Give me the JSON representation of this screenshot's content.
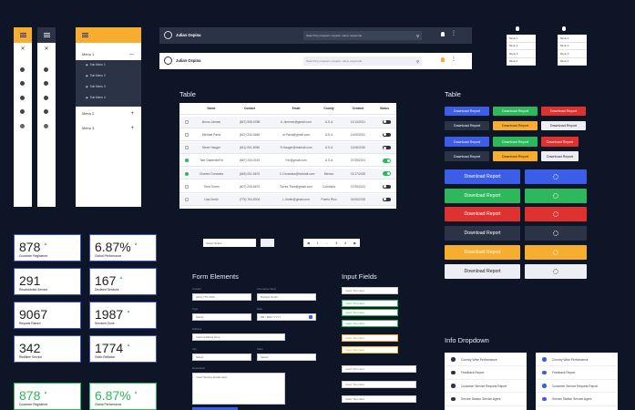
{
  "colors": {
    "bg": "#0e1526",
    "yellow": "#f7ae2f",
    "blue": "#3b5de7",
    "green": "#2eb85c",
    "red": "#e03131",
    "dark": "#2b3447",
    "light": "#eceef3"
  },
  "header": {
    "user": "Julian Ospina",
    "search_placeholder": "Search by prospect, request, name, keywords"
  },
  "sidebar_big": {
    "items": [
      {
        "label": "Menu 1"
      },
      {
        "label": "Sub Menu 1"
      },
      {
        "label": "Sub Menu 2"
      },
      {
        "label": "Sub Menu 3"
      },
      {
        "label": "Sub Menu 4"
      },
      {
        "label": "Menu 2"
      },
      {
        "label": "Menu 3"
      }
    ]
  },
  "small_menus": {
    "left": [
      "Menu 1",
      "Menu 2",
      "Menu 3",
      "Menu 4"
    ],
    "right": [
      "Menu 1",
      "Menu 2",
      "Menu 3",
      "Menu 4"
    ]
  },
  "table": {
    "title": "Table",
    "columns": [
      "Name",
      "Contact",
      "Email",
      "County",
      "Created",
      "Status"
    ],
    "rows": [
      {
        "name": "Bruno Jaimes",
        "contact": "(667) 998-0098",
        "email": "b.Jimenez@gmail.com",
        "county": "U.S.A",
        "created": "11/14/2021",
        "checked": false,
        "status": false
      },
      {
        "name": "Michael Parra",
        "contact": "(612) 234-0660",
        "email": "m.Parra@gmail.com",
        "county": "U.S.A",
        "created": "11/05/2021",
        "checked": false,
        "status": false
      },
      {
        "name": "Steve Hauger",
        "contact": "(611) 001-5050",
        "email": "S.Hauger@hotmail.com",
        "county": "U.S.A",
        "created": "11/08/2020",
        "checked": false,
        "status": false
      },
      {
        "name": "Tom Gabrielle/Fei",
        "contact": "(667) 234-0019",
        "email": "Fei@gmail.com",
        "county": "U.S.A",
        "created": "07/25/2021",
        "checked": true,
        "status": true
      },
      {
        "name": "Charles Gonzales",
        "contact": "(645) 001-5670",
        "email": "C.Gonzales@hotmail.com",
        "county": "Mexico",
        "created": "01/17/2020",
        "checked": true,
        "status": true
      },
      {
        "name": "Thea Torres",
        "contact": "(607) 235-6670",
        "email": "Torres.Thea@gmail.com",
        "county": "Colombia",
        "created": "07/25/2021",
        "checked": false,
        "status": false
      },
      {
        "name": "Lisa Smith",
        "contact": "(775) 764-5004",
        "email": "L.Smith@gmail.com",
        "county": "Puerto Rico",
        "created": "01/06/2020",
        "checked": false,
        "status": false
      }
    ],
    "select_placeholder": "Select Select",
    "pagination": [
      "◀",
      "1",
      "...",
      "5",
      "6",
      "▶"
    ]
  },
  "buttons": {
    "title": "Table",
    "label": "Download Report"
  },
  "stats": [
    {
      "value": "878",
      "label": "Customer Registered",
      "trend": "up"
    },
    {
      "value": "6.87%",
      "label": "Global Performance",
      "trend": "up"
    },
    {
      "value": "291",
      "label": "Rescheduled Service",
      "trend": "down"
    },
    {
      "value": "167",
      "label": "Declined Services",
      "trend": "up"
    },
    {
      "value": "9067",
      "label": "Request Raised",
      "trend": "down"
    },
    {
      "value": "1987",
      "label": "Services Gone",
      "trend": "up"
    },
    {
      "value": "342",
      "label": "Realtime Service",
      "trend": "down"
    },
    {
      "value": "1774",
      "label": "Video Reflation",
      "trend": "up"
    },
    {
      "value": "878",
      "label": "Customer Registered",
      "trend": "up"
    },
    {
      "value": "6.87%",
      "label": "Global Performance",
      "trend": "up"
    }
  ],
  "form": {
    "title": "Form Elements",
    "fields": [
      {
        "label": "Contact",
        "value": "(213) 775-7490"
      },
      {
        "label": "Username Name",
        "value": "Richard Smith"
      },
      {
        "label": "Type",
        "value": "Select"
      },
      {
        "label": "Date",
        "value": "DD / MM / YYYY"
      },
      {
        "label": "Address",
        "value": "Insert Address Here"
      },
      {
        "label": "City",
        "value": "Select"
      },
      {
        "label": "State",
        "value": "Select"
      },
      {
        "label": "Description",
        "value": "Insert Service Detail Here"
      }
    ]
  },
  "inputs": {
    "title": "Input Fields",
    "items": [
      "Insert Text Here",
      "Insert Text Here",
      "Insert Text Here",
      "Insert Text Here",
      "Insert Text Here",
      "Insert Text Here",
      "Insert Text Here",
      "Insert Text Here"
    ]
  },
  "info_dropdown": {
    "title": "Info Dropdown",
    "left": [
      "Country Wise Performance",
      "Feedback Report",
      "Customer Service Request Report",
      "Service Station Service Agent"
    ],
    "right": [
      "Country Wise Performance",
      "Feedback Report",
      "Customer Service Request Report",
      "Service Station Service Agent"
    ]
  }
}
